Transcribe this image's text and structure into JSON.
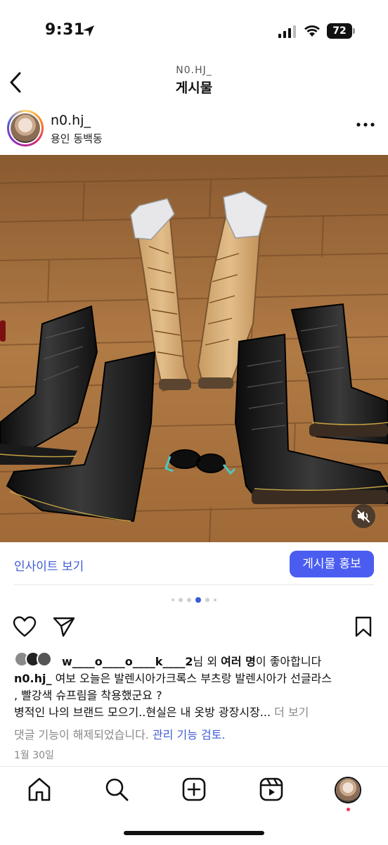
{
  "status_bar": {
    "time": "9:31",
    "battery": "72"
  },
  "header": {
    "subtitle": "N0.HJ_",
    "title": "게시물"
  },
  "post": {
    "username": "n0.hj_",
    "location": "용인 동백동"
  },
  "insights": {
    "link_label": "인사이트 보기",
    "promote_label": "게시물 홍보"
  },
  "carousel": {
    "count": 6,
    "active_index": 3
  },
  "likes": {
    "liker_name": "w____o____o____k____2",
    "suffix_1": "님 외 ",
    "bold_part": "여러 명",
    "suffix_2": "이 좋아합니다"
  },
  "caption": {
    "username": "n0.hj_",
    "text_line1": " 여보 오늘은 발렌시아가크록스 부츠랑 발렌시아가 선글라스",
    "text_line2": ", 빨강색 슈프림을 착용했군요 ?",
    "text_line3": "병적인 나의 브랜드 모으기..현실은 내 옷방 광장시장... ",
    "more_label": "더 보기"
  },
  "comments": {
    "disabled_text": "댓글 기능이 해제되었습니다. ",
    "review_label": "관리 기능 검토."
  },
  "date": "1월 30일",
  "colors": {
    "accent_blue": "#4a5df0",
    "link_blue": "#3f5bd8",
    "floor_brown": "#9b6a3c"
  },
  "icons": [
    "back-icon",
    "more-icon",
    "heart-icon",
    "send-icon",
    "bookmark-icon",
    "home-icon",
    "search-icon",
    "create-icon",
    "reels-icon",
    "mute-icon"
  ]
}
